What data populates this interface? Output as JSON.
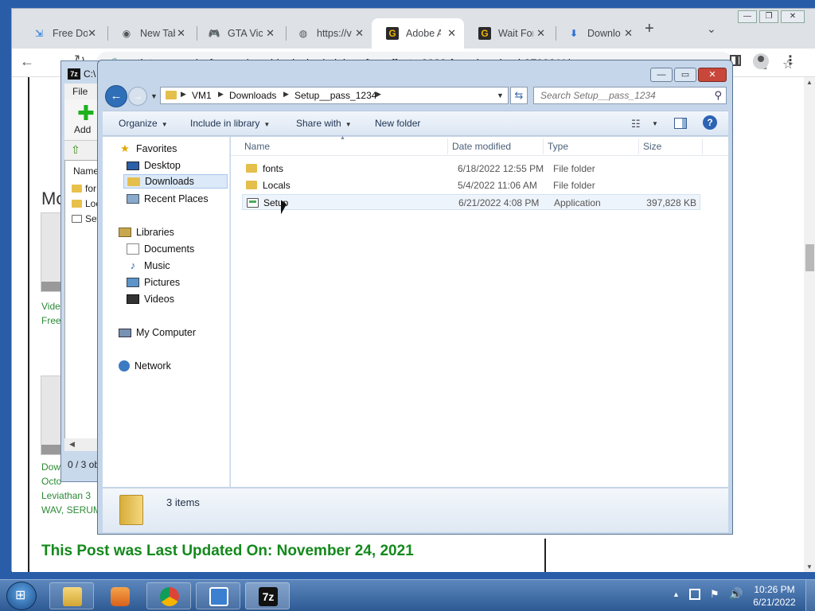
{
  "browser": {
    "tabs": [
      {
        "label": "Free Dov",
        "icon": "download-tab-icon"
      },
      {
        "label": "New Tab",
        "icon": "chrome-tab-icon"
      },
      {
        "label": "GTA Vic",
        "icon": "gamepad-tab-icon"
      },
      {
        "label": "https://v",
        "icon": "globe-tab-icon"
      },
      {
        "label": "Adobe A",
        "icon": "g-logo-tab-icon",
        "active": true
      },
      {
        "label": "Wait For",
        "icon": "g-logo-tab-icon"
      },
      {
        "label": "Downlo",
        "icon": "download-arrow-tab-icon"
      }
    ],
    "url": "getintopc.com/softwares/graphic-design/adobe-after-effects-2022-free-download-8792311/",
    "page": {
      "heading_partial": "Mo",
      "link1_line1": "Vide",
      "link1_line2": "Free",
      "link2_line1": "Dow",
      "link2_line2": "Octo",
      "link2_line3": "Leviathan 3",
      "link2_line4": "WAV, SERUM)",
      "post_updated": "This Post was Last Updated On: November 24, 2021"
    }
  },
  "sevenzip": {
    "title": "C:\\",
    "logo": "7z",
    "menu_file": "File",
    "add_label": "Add",
    "column_name": "Name",
    "rows": [
      "for",
      "Loc",
      "Set"
    ],
    "status": "0 / 3 ob"
  },
  "explorer": {
    "breadcrumb": [
      "VM1",
      "Downloads",
      "Setup__pass_1234"
    ],
    "search_placeholder": "Search Setup__pass_1234",
    "commands": {
      "organize": "Organize",
      "include": "Include in library",
      "share": "Share with",
      "new_folder": "New folder"
    },
    "nav": {
      "favorites": "Favorites",
      "desktop": "Desktop",
      "downloads": "Downloads",
      "recent": "Recent Places",
      "libraries": "Libraries",
      "documents": "Documents",
      "music": "Music",
      "pictures": "Pictures",
      "videos": "Videos",
      "computer": "My Computer",
      "network": "Network"
    },
    "columns": {
      "name": "Name",
      "date": "Date modified",
      "type": "Type",
      "size": "Size"
    },
    "files": [
      {
        "name": "fonts",
        "date": "6/18/2022 12:55 PM",
        "type": "File folder",
        "size": ""
      },
      {
        "name": "Locals",
        "date": "5/4/2022 11:06 AM",
        "type": "File folder",
        "size": ""
      },
      {
        "name": "Setup",
        "date": "6/21/2022 4:08 PM",
        "type": "Application",
        "size": "397,828 KB"
      }
    ],
    "item_count": "3 items"
  },
  "taskbar": {
    "time": "10:26 PM",
    "date": "6/21/2022",
    "zip_label": "7z"
  }
}
